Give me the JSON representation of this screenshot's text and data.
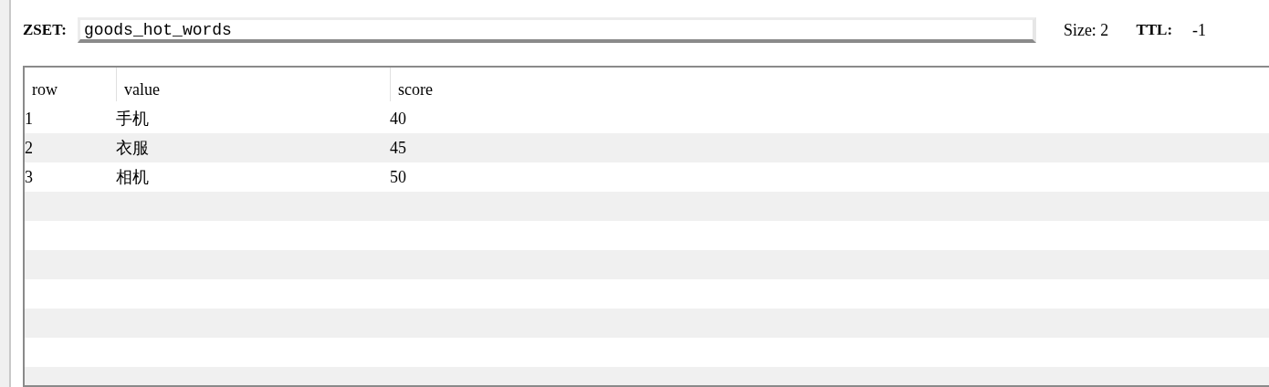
{
  "key_bar": {
    "type_label": "ZSET:",
    "key_name": "goods_hot_words",
    "size": "Size: 2",
    "ttl_label": "TTL:",
    "ttl_value": "-1"
  },
  "table": {
    "columns": [
      "row",
      "value",
      "score"
    ],
    "rows": [
      [
        "1",
        "手机",
        "40"
      ],
      [
        "2",
        "衣服",
        "45"
      ],
      [
        "3",
        "相机",
        "50"
      ]
    ]
  }
}
